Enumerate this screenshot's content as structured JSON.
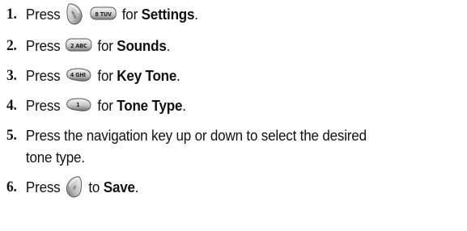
{
  "steps": [
    {
      "num": "1.",
      "press": "Press",
      "mid": "for",
      "action": "Settings",
      "end": ".",
      "keys": [
        {
          "icon": "menu-ok-key-icon",
          "label": "MENU"
        },
        {
          "icon": "number-key-icon",
          "label": "8 TUV"
        }
      ]
    },
    {
      "num": "2.",
      "press": "Press",
      "mid": "for",
      "action": "Sounds",
      "end": ".",
      "keys": [
        {
          "icon": "number-key-icon",
          "label": "2 ABC"
        }
      ]
    },
    {
      "num": "3.",
      "press": "Press",
      "mid": "for",
      "action": "Key Tone",
      "end": ".",
      "keys": [
        {
          "icon": "number-key-icon",
          "label": "4 GHI"
        }
      ]
    },
    {
      "num": "4.",
      "press": "Press",
      "mid": "for",
      "action": "Tone Type",
      "end": ".",
      "keys": [
        {
          "icon": "number-key-icon",
          "label": "1"
        }
      ]
    },
    {
      "num": "5.",
      "line1": "Press the navigation key up or down to select the desired",
      "line2": "tone type."
    },
    {
      "num": "6.",
      "press": "Press",
      "mid": "to",
      "action": "Save",
      "end": ".",
      "keys": [
        {
          "icon": "menu-ok-key-icon",
          "label": "OK"
        }
      ]
    }
  ]
}
